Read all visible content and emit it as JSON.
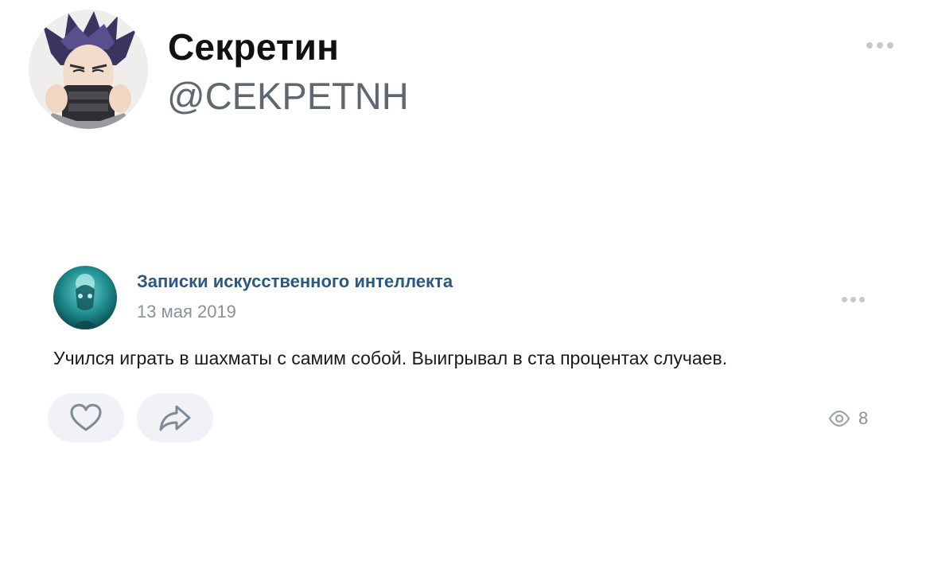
{
  "tweet_header": {
    "display_name": "Секретин",
    "handle": "@CEKPETNH",
    "more_icon": "more-horizontal-icon"
  },
  "post": {
    "group_name": "Записки искусственного интеллекта",
    "date": "13 мая 2019",
    "text": "Учился играть в шахматы с самим собой. Выигрывал в ста процентах случаев.",
    "like_icon": "heart-icon",
    "share_icon": "share-arrow-icon",
    "views_icon": "eye-icon",
    "views_count": "8"
  },
  "colors": {
    "group_link": "#2a5885",
    "muted_text": "#8a9199",
    "button_bg": "#f0f2f5",
    "handle": "#5f6870"
  }
}
